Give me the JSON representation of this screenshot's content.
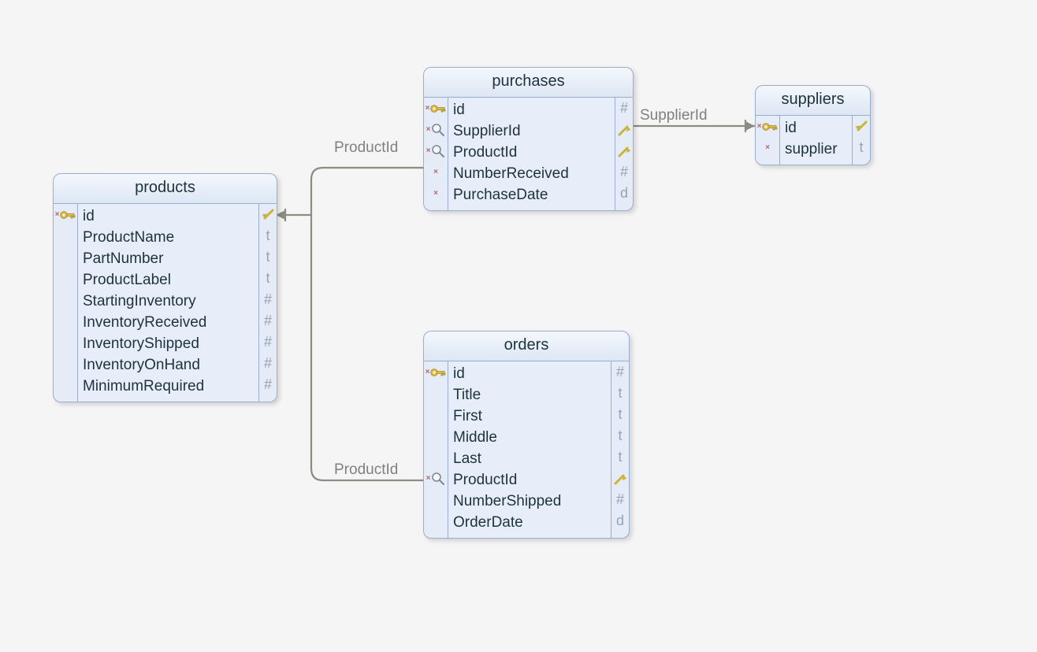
{
  "entities": {
    "products": {
      "title": "products",
      "columns": [
        {
          "name": "id",
          "icon": "key",
          "type": "",
          "fk": "in"
        },
        {
          "name": "ProductName",
          "icon": "",
          "type": "t"
        },
        {
          "name": "PartNumber",
          "icon": "",
          "type": "t"
        },
        {
          "name": "ProductLabel",
          "icon": "",
          "type": "t"
        },
        {
          "name": "StartingInventory",
          "icon": "",
          "type": "#"
        },
        {
          "name": "InventoryReceived",
          "icon": "",
          "type": "#"
        },
        {
          "name": "InventoryShipped",
          "icon": "",
          "type": "#"
        },
        {
          "name": "InventoryOnHand",
          "icon": "",
          "type": "#"
        },
        {
          "name": "MinimumRequired",
          "icon": "",
          "type": "#"
        }
      ]
    },
    "purchases": {
      "title": "purchases",
      "columns": [
        {
          "name": "id",
          "icon": "key",
          "type": "#"
        },
        {
          "name": "SupplierId",
          "icon": "lens",
          "type": "",
          "fk": "out"
        },
        {
          "name": "ProductId",
          "icon": "lens",
          "type": "",
          "fk": "out"
        },
        {
          "name": "NumberReceived",
          "icon": "x",
          "type": "#"
        },
        {
          "name": "PurchaseDate",
          "icon": "x",
          "type": "d"
        }
      ]
    },
    "orders": {
      "title": "orders",
      "columns": [
        {
          "name": "id",
          "icon": "key",
          "type": "#"
        },
        {
          "name": "Title",
          "icon": "",
          "type": "t"
        },
        {
          "name": "First",
          "icon": "",
          "type": "t"
        },
        {
          "name": "Middle",
          "icon": "",
          "type": "t"
        },
        {
          "name": "Last",
          "icon": "",
          "type": "t"
        },
        {
          "name": "ProductId",
          "icon": "lens",
          "type": "",
          "fk": "out"
        },
        {
          "name": "NumberShipped",
          "icon": "",
          "type": "#"
        },
        {
          "name": "OrderDate",
          "icon": "",
          "type": "d"
        }
      ]
    },
    "suppliers": {
      "title": "suppliers",
      "columns": [
        {
          "name": "id",
          "icon": "key",
          "type": "",
          "fk": "in"
        },
        {
          "name": "supplier",
          "icon": "x",
          "type": "t"
        }
      ]
    }
  },
  "relationships": [
    {
      "label": "ProductId",
      "from": "purchases.ProductId",
      "to": "products.id"
    },
    {
      "label": "ProductId",
      "from": "orders.ProductId",
      "to": "products.id"
    },
    {
      "label": "SupplierId",
      "from": "purchases.SupplierId",
      "to": "suppliers.id"
    }
  ],
  "type_legend": {
    "#": "number",
    "t": "text",
    "d": "date",
    "": ""
  }
}
